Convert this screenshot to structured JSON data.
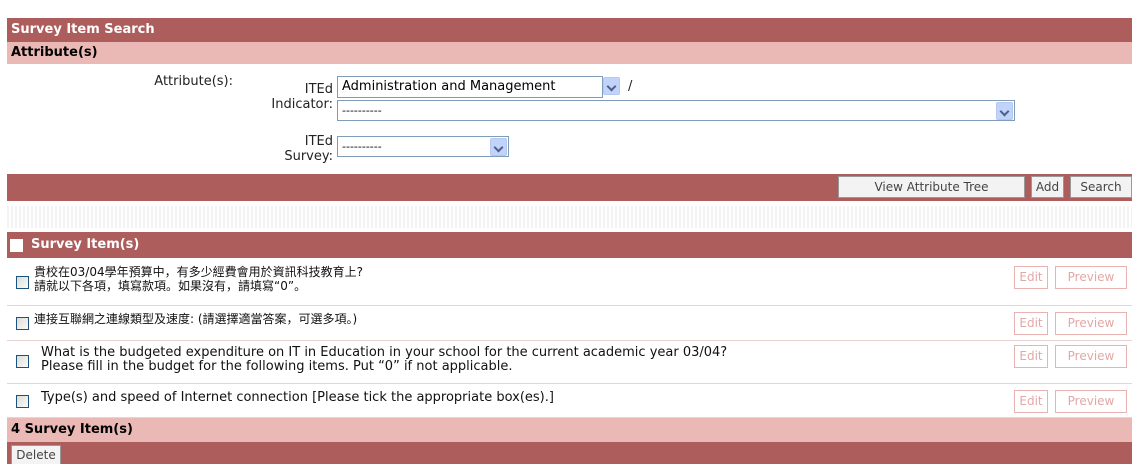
{
  "title": "Survey Item Search",
  "attributes_section": {
    "header": "Attribute(s)",
    "label": "Attribute(s):",
    "indicator_label_line1": "ITEd",
    "indicator_label_line2": "Indicator:",
    "category_select_value": "Administration and Management",
    "slash": "/",
    "indicator_select_value": "----------",
    "survey_label_line1": "ITEd",
    "survey_label_line2": "Survey:",
    "survey_select_value": "----------"
  },
  "toolbar": {
    "view_tree_label": "View Attribute Tree",
    "add_label": "Add",
    "search_label": "Search"
  },
  "items_section": {
    "header": "Survey Item(s)",
    "items": [
      {
        "lines": [
          "貴校在03/04學年預算中，有多少經費會用於資訊科技教育上?",
          "請就以下各項，填寫款項。如果沒有，請填寫“0”。"
        ],
        "edit": "Edit",
        "preview": "Preview"
      },
      {
        "lines": [
          "連接互聯網之連線類型及速度: (請選擇適當答案，可選多項。)"
        ],
        "edit": "Edit",
        "preview": "Preview"
      },
      {
        "lines": [
          "What is the budgeted expenditure on IT in Education in your school for the current academic year 03/04?",
          "Please fill in the budget for the following items. Put “0” if not applicable."
        ],
        "edit": "Edit",
        "preview": "Preview"
      },
      {
        "lines": [
          "Type(s) and speed of Internet connection [Please tick the appropriate box(es).]"
        ],
        "edit": "Edit",
        "preview": "Preview"
      }
    ],
    "count_text": "4 Survey Item(s)",
    "delete_label": "Delete"
  },
  "colors": {
    "dark_bar": "#ad5d5b",
    "light_bar": "#eab9b5",
    "disabled_button_text": "#e2a8a6"
  }
}
